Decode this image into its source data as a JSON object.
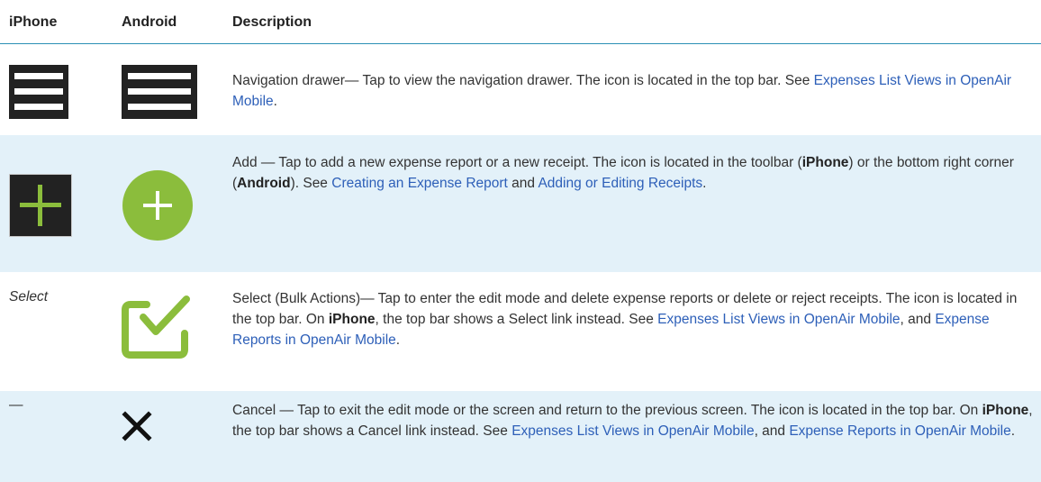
{
  "headers": {
    "iphone": "iPhone",
    "android": "Android",
    "description": "Description"
  },
  "colors": {
    "header_rule": "#2a8fb5",
    "row_shade": "#e3f1f9",
    "link": "#2d5fb8",
    "icon_dark": "#222222",
    "icon_green": "#8bbd3c"
  },
  "rows": [
    {
      "iphone_icon": "hamburger-menu-icon",
      "android_icon": "hamburger-menu-icon",
      "desc": {
        "t1": "Navigation drawer— Tap to view the navigation drawer. The icon is located in the top bar. See ",
        "link1": "Expenses List Views in OpenAir Mobile",
        "t2": "."
      }
    },
    {
      "iphone_icon": "plus-square-icon",
      "android_icon": "plus-circle-icon",
      "desc": {
        "t1": "Add — Tap to add a new expense report or a new receipt. The icon is located in the toolbar (",
        "b1": "iPhone",
        "t2": ") or the bottom right corner (",
        "b2": "Android",
        "t3": "). See ",
        "link1": "Creating an Expense Report",
        "t4": " and ",
        "link2": "Adding or Editing Receipts",
        "t5": "."
      }
    },
    {
      "iphone_text": "Select",
      "android_icon": "checkbox-check-icon",
      "desc": {
        "t1": "Select (Bulk Actions)— Tap to enter the edit mode and delete expense reports or delete or reject receipts. The icon is located in the top bar. On ",
        "b1": "iPhone",
        "t2": ", the top bar shows a Select link instead. See ",
        "link1": "Expenses List Views in OpenAir Mobile",
        "t3": ", and ",
        "link2": "Expense Reports in OpenAir Mobile",
        "t4": "."
      }
    },
    {
      "iphone_text": "—",
      "android_icon": "close-x-icon",
      "desc": {
        "t1": "Cancel — Tap to exit the edit mode or the screen and return to the previous screen. The icon is located in the top bar. On ",
        "b1": "iPhone",
        "t2": ", the top bar shows a Cancel link instead. See ",
        "link1": "Expenses List Views in OpenAir Mobile",
        "t3": ", and ",
        "link2": "Expense Reports in OpenAir Mobile",
        "t4": "."
      }
    }
  ]
}
